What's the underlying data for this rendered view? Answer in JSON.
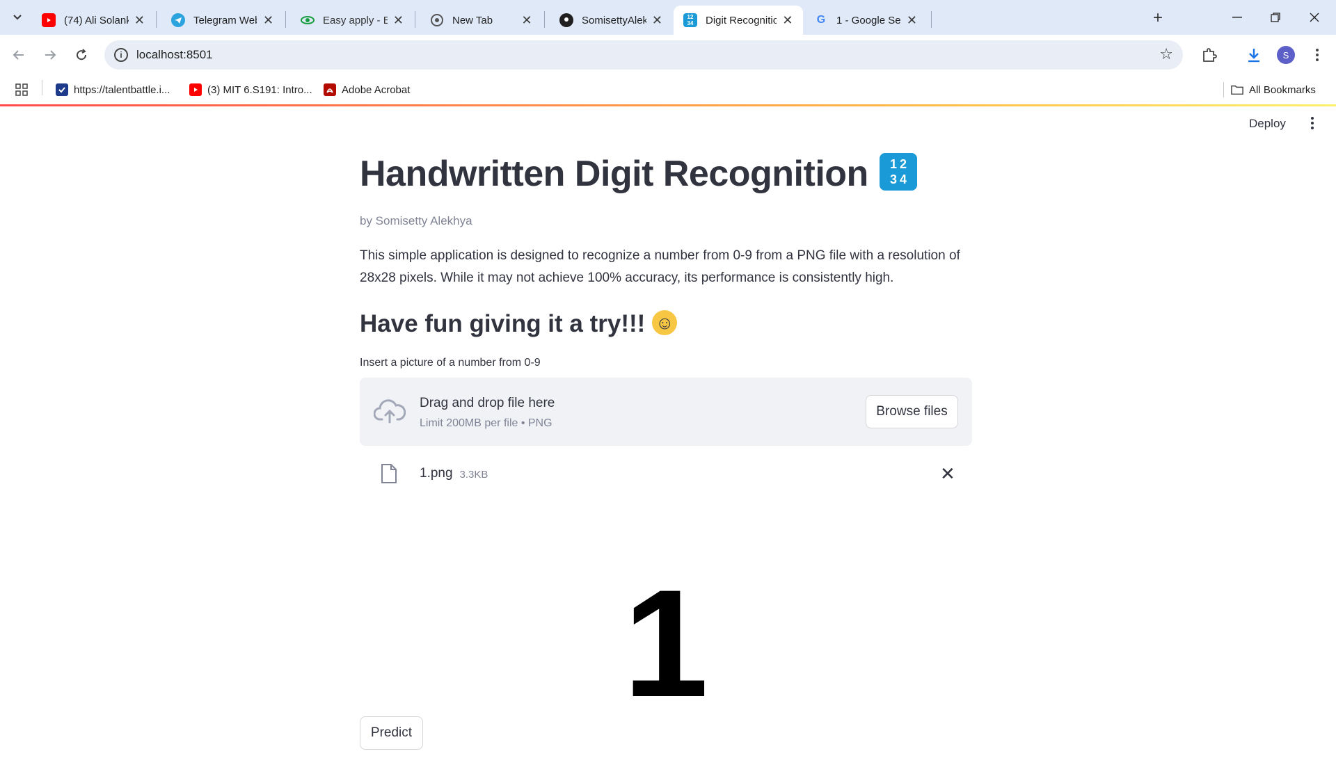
{
  "browser": {
    "tabs": [
      {
        "title": "(74) Ali Solanki - YouTube",
        "icon": "youtube-icon",
        "active": false
      },
      {
        "title": "Telegram Web",
        "icon": "telegram-icon",
        "active": false
      },
      {
        "title": "Easy apply - Early Talent",
        "icon": "eye-icon",
        "active": false
      },
      {
        "title": "New Tab",
        "icon": "chrome-icon",
        "active": false
      },
      {
        "title": "SomisettyAlekhya · GitHub",
        "icon": "github-icon",
        "active": false
      },
      {
        "title": "Digit Recognition",
        "icon": "digits-1234-icon",
        "active": true
      },
      {
        "title": "1 - Google Search",
        "icon": "google-icon",
        "active": false
      }
    ],
    "address": "localhost:8501",
    "profile_initial": "S",
    "bookmarks": [
      {
        "label": "https://talentbattle.i...",
        "icon": "talentbattle-icon"
      },
      {
        "label": "(3) MIT 6.S191: Intro...",
        "icon": "youtube-icon"
      },
      {
        "label": "Adobe Acrobat",
        "icon": "acrobat-icon"
      }
    ],
    "all_bookmarks": "All Bookmarks",
    "colors": {
      "tabstrip": "#dfe9f8",
      "omnibox": "#e9eef6",
      "accent_start": "#ff4b4b",
      "accent_end": "#fff06a"
    }
  },
  "app": {
    "deploy_label": "Deploy",
    "title": "Handwritten Digit Recognition",
    "title_emoji": "1 2 3 4",
    "byline": "by Somisetty Alekhya",
    "description": "This simple application is designed to recognize a number from 0-9 from a PNG file with a resolution of 28x28 pixels. While it may not achieve 100% accuracy, its performance is consistently high.",
    "subheading": "Have fun giving it a try!!!",
    "uploader": {
      "label": "Insert a picture of a number from 0-9",
      "drag_text": "Drag and drop file here",
      "limit_text": "Limit 200MB per file • PNG",
      "browse_label": "Browse files"
    },
    "uploaded_file": {
      "name": "1.png",
      "size": "3.3KB"
    },
    "preview_digit": "1",
    "predict_label": "Predict"
  }
}
